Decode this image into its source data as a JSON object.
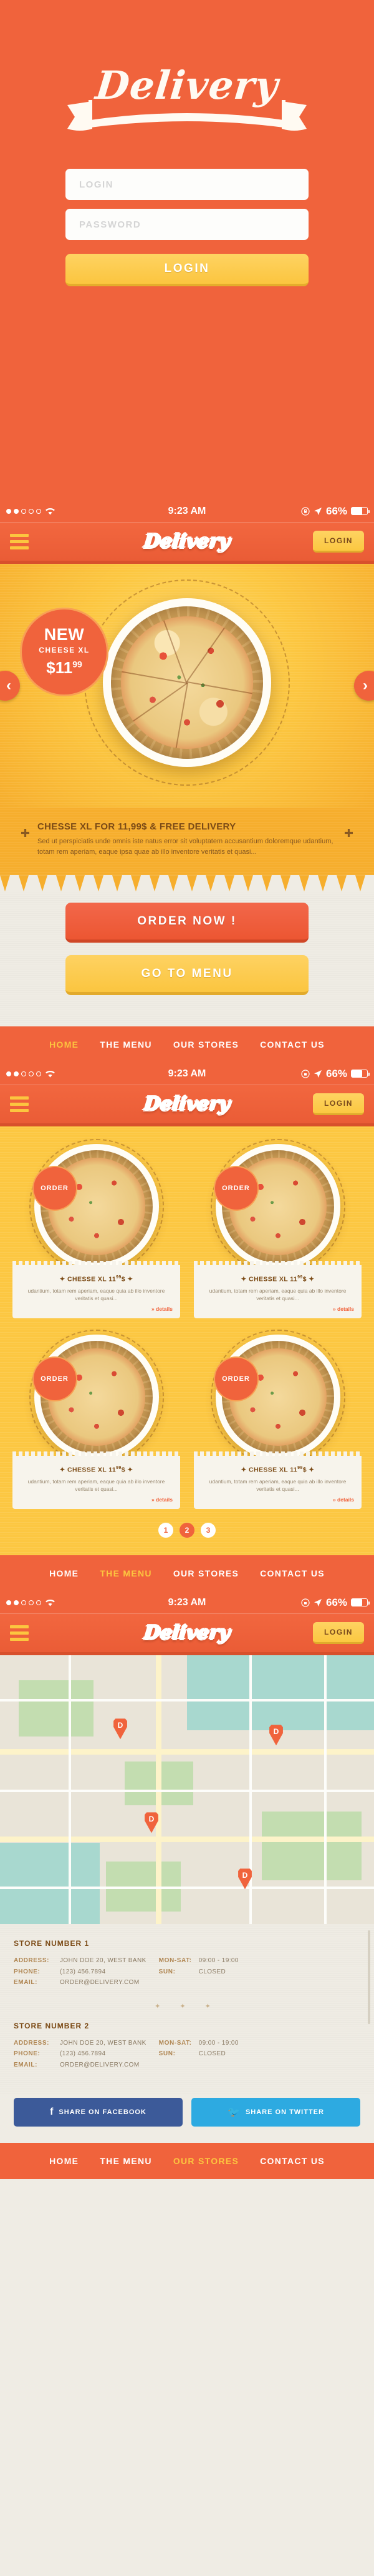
{
  "brand": {
    "name": "Delivery",
    "accent": "#f0633c",
    "yellow": "#fcc63f",
    "cream": "#efece4"
  },
  "login_screen": {
    "logo": "Delivery",
    "username_placeholder": "LOGIN",
    "username_value": "",
    "password_placeholder": "PASSWORD",
    "password_value": "",
    "submit_label": "LOGIN"
  },
  "statusbar": {
    "signal_filled": 2,
    "signal_total": 5,
    "wifi": "wifi-icon",
    "time": "9:23 AM",
    "rotation_lock": "rotation-lock-icon",
    "location": "location-arrow-icon",
    "battery_percent": "66%",
    "battery_level": 66
  },
  "header": {
    "menu_icon": "hamburger-icon",
    "logo": "Delivery",
    "login_label": "LOGIN"
  },
  "home_screen": {
    "badge": {
      "line1": "NEW",
      "line2": "CHEESE XL",
      "price_main": "$11",
      "price_cents": "99"
    },
    "prev_label": "‹",
    "next_label": "›",
    "caption_title": "CHESSE XL FOR  11,99$ & FREE DELIVERY",
    "caption_body": "Sed ut perspiciatis unde omnis iste natus error sit voluptatem accusantium doloremque udantium, totam rem aperiam, eaque ipsa quae ab illo inventore veritatis et quasi...",
    "order_now_label": "ORDER NOW !",
    "go_to_menu_label": "GO TO MENU"
  },
  "bottom_nav_home": [
    {
      "label": "HOME",
      "active": true
    },
    {
      "label": "THE MENU",
      "active": false
    },
    {
      "label": "OUR STORES",
      "active": false
    },
    {
      "label": "CONTACT US",
      "active": false
    }
  ],
  "bottom_nav_menu": [
    {
      "label": "HOME",
      "active": false
    },
    {
      "label": "THE MENU",
      "active": true
    },
    {
      "label": "OUR STORES",
      "active": false
    },
    {
      "label": "CONTACT US",
      "active": false
    }
  ],
  "bottom_nav_stores": [
    {
      "label": "HOME",
      "active": false
    },
    {
      "label": "THE MENU",
      "active": false
    },
    {
      "label": "OUR STORES",
      "active": true
    },
    {
      "label": "CONTACT US",
      "active": false
    }
  ],
  "menu_screen": {
    "order_badge_label": "ORDER",
    "details_label": "» details",
    "cards": [
      {
        "title": "✦ CHESSE XL  11",
        "cents": "99",
        "currency": "$ ✦",
        "desc": "udantium, totam rem aperiam, eaque quia ab illo inventore veritatis et quasi..."
      },
      {
        "title": "✦ CHESSE XL  11",
        "cents": "99",
        "currency": "$ ✦",
        "desc": "udantium, totam rem aperiam, eaque quia ab illo inventore veritatis et quasi..."
      },
      {
        "title": "✦ CHESSE XL  11",
        "cents": "99",
        "currency": "$ ✦",
        "desc": "udantium, totam rem aperiam, eaque quia ab illo inventore veritatis et quasi..."
      },
      {
        "title": "✦ CHESSE XL  11",
        "cents": "99",
        "currency": "$ ✦",
        "desc": "udantium, totam rem aperiam, eaque quia ab illo inventore veritatis et quasi..."
      }
    ],
    "pages": [
      {
        "label": "1",
        "active": false
      },
      {
        "label": "2",
        "active": true
      },
      {
        "label": "3",
        "active": false
      }
    ]
  },
  "stores_screen": {
    "map_pins": [
      "D",
      "D",
      "D",
      "D"
    ],
    "divider": "✦ ✦ ✦",
    "stores": [
      {
        "heading": "STORE NUMBER 1",
        "address_label": "ADDRESS:",
        "address_value": "JOHN DOE 20, WEST BANK",
        "phone_label": "PHONE:",
        "phone_value": "(123) 456.7894",
        "email_label": "EMAIL:",
        "email_value": "ORDER@DELIVERY.COM",
        "hours_label_1": "MON-SAT:",
        "hours_value_1": "09:00 - 19:00",
        "hours_label_2": "SUN:",
        "hours_value_2": "CLOSED"
      },
      {
        "heading": "STORE NUMBER 2",
        "address_label": "ADDRESS:",
        "address_value": "JOHN DOE 20, WEST BANK",
        "phone_label": "PHONE:",
        "phone_value": "(123) 456.7894",
        "email_label": "EMAIL:",
        "email_value": "ORDER@DELIVERY.COM",
        "hours_label_1": "MON-SAT:",
        "hours_value_1": "09:00 - 19:00",
        "hours_label_2": "SUN:",
        "hours_value_2": "CLOSED"
      }
    ],
    "facebook_label": "SHARE ON FACEBOOK",
    "twitter_label": "SHARE ON TWITTER"
  }
}
